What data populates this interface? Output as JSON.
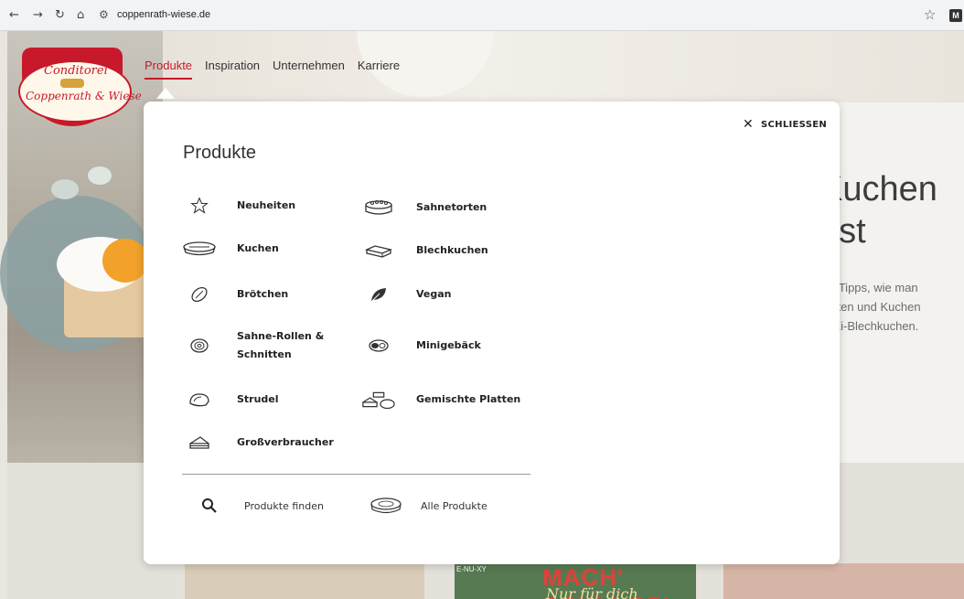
{
  "browser": {
    "url": "coppenrath-wiese.de",
    "ext_label": "M"
  },
  "logo": {
    "line1": "Conditorei",
    "line2": "Coppenrath & Wiese"
  },
  "nav": {
    "items": [
      "Produkte",
      "Inspiration",
      "Unternehmen",
      "Karriere"
    ]
  },
  "hero": {
    "title_line1": "Kuchen",
    "title_line2": "est",
    "text_line1": "ele Tipps, wie man",
    "text_line2": "rtorten und Kuchen",
    "text_line3": "el-Ei-Blechkuchen."
  },
  "menu": {
    "close_label": "SCHLIESSEN",
    "title": "Produkte",
    "left_items": [
      "Neuheiten",
      "Kuchen",
      "Brötchen",
      "Sahne-Rollen &",
      "Strudel",
      "Großverbraucher"
    ],
    "left_item4_line2": "Schnitten",
    "right_items": [
      "Sahnetorten",
      "Blechkuchen",
      "Vegan",
      "Minigebäck",
      "Gemischte Platten"
    ],
    "footer": {
      "find_label": "Produkte finden",
      "all_label": "Alle Produkte"
    }
  },
  "teasers": {
    "card2_headline": "MACH' SCHLUSS!",
    "card2_sub": "Nur für dich",
    "card2_tag": "E-NU-XY"
  }
}
